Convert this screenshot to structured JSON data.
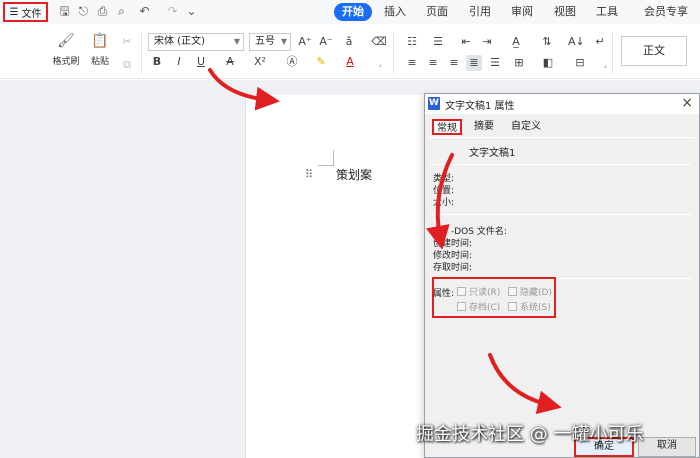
{
  "topbar": {
    "file_label": "文件",
    "tabs": [
      "开始",
      "插入",
      "页面",
      "引用",
      "审阅",
      "视图",
      "工具",
      "会员专享"
    ]
  },
  "ribbon": {
    "format_painter": "格式刷",
    "paste": "粘贴",
    "font_name": "宋体 (正文)",
    "font_size": "五号",
    "style_normal": "正文"
  },
  "document": {
    "text": "策划案"
  },
  "dialog": {
    "title": "文字文稿1 属性",
    "close": "×",
    "tabs": [
      "常规",
      "摘要",
      "自定义"
    ],
    "doc_name": "文字文稿1",
    "fields_1": [
      "类型:",
      "位置:",
      "大小:"
    ],
    "fields_2": [
      "-DOS 文件名:",
      "创建时间:",
      "修改时间:",
      "存取时间:"
    ],
    "attributes_label": "属性:",
    "checkboxes": [
      "只读(R)",
      "隐藏(D)",
      "存档(C)",
      "系统(S)"
    ],
    "ok": "确定",
    "cancel": "取消"
  },
  "watermark": "掘金技术社区 @ 一罐小可乐",
  "colors": {
    "accent": "#1a6ef5",
    "highlight": "#e02020"
  }
}
